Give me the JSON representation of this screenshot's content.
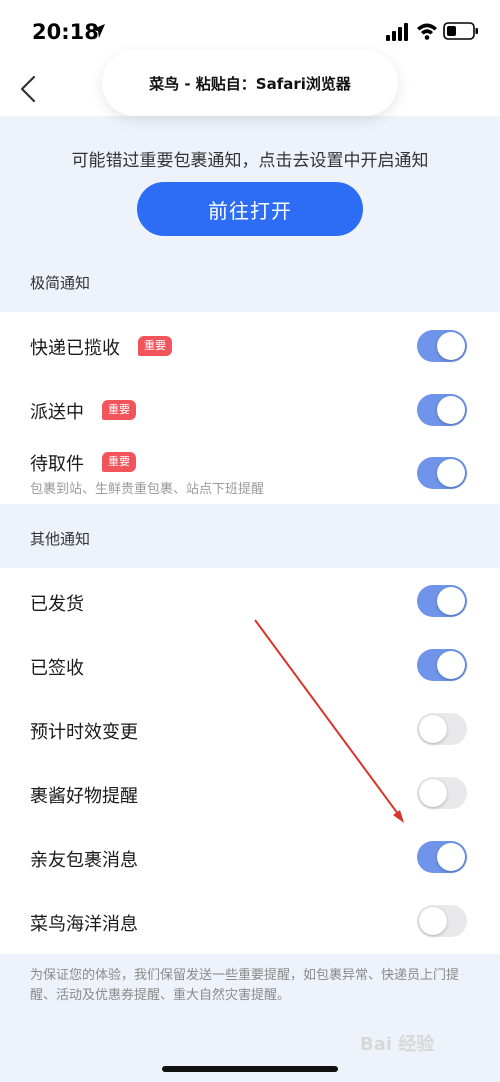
{
  "status_bar": {
    "time": "20:18"
  },
  "nav": {
    "paste_banner": "菜鸟 - 粘贴自：Safari浏览器"
  },
  "notice": {
    "text": "可能错过重要包裹通知，点击去设置中开启通知",
    "button_label": "前往打开"
  },
  "sections": [
    {
      "title": "极简通知",
      "items": [
        {
          "label": "快递已揽收",
          "badge": "重要",
          "sub": "",
          "enabled": true
        },
        {
          "label": "派送中",
          "badge": "重要",
          "sub": "",
          "enabled": true
        },
        {
          "label": "待取件",
          "badge": "重要",
          "sub": "包裹到站、生鲜贵重包裹、站点下班提醒",
          "enabled": true
        }
      ]
    },
    {
      "title": "其他通知",
      "items": [
        {
          "label": "已发货",
          "enabled": true
        },
        {
          "label": "已签收",
          "enabled": true
        },
        {
          "label": "预计时效变更",
          "enabled": false
        },
        {
          "label": "裹酱好物提醒",
          "enabled": false
        },
        {
          "label": "亲友包裹消息",
          "enabled": true
        },
        {
          "label": "菜鸟海洋消息",
          "enabled": false
        }
      ]
    }
  ],
  "footer_note": "为保证您的体验，我们保留发送一些重要提醒，如包裹异常、快递员上门提醒、活动及优惠券提醒、重大自然灾害提醒。",
  "watermark": "Bai 经验",
  "colors": {
    "accent": "#2d6df6",
    "toggle_on": "#6f94ea",
    "badge": "#f2545b",
    "annotation_arrow": "#d9342b"
  }
}
